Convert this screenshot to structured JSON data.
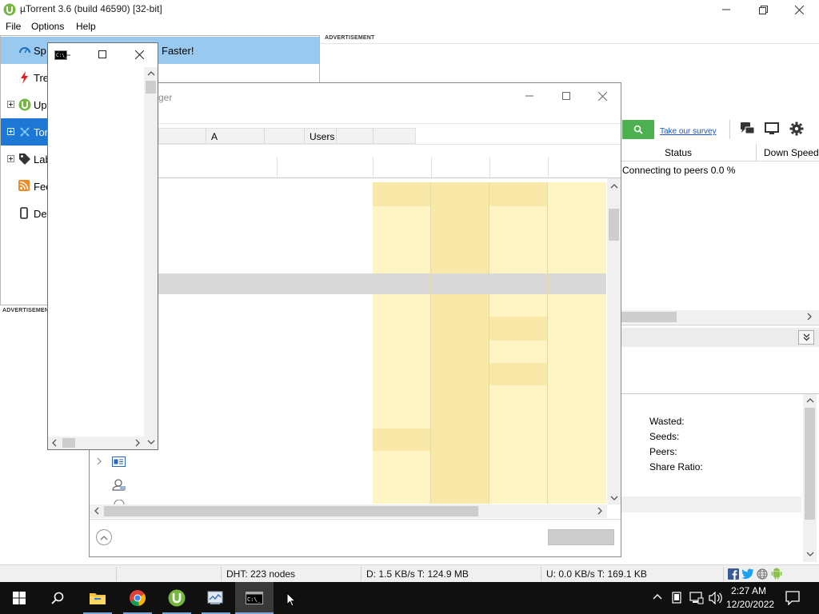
{
  "app": {
    "title": "µTorrent 3.6  (build 46590) [32-bit]",
    "menu": [
      "File",
      "Options",
      "Help"
    ]
  },
  "sidebar": {
    "items": [
      {
        "label": "Sp",
        "icon": "speedometer-icon"
      },
      {
        "label": "Tre",
        "icon": "lightning-icon"
      },
      {
        "label": "Up",
        "icon": "utorrent-icon"
      },
      {
        "label": "Tor",
        "icon": "torrents-icon"
      },
      {
        "label": "Lab",
        "icon": "tag-icon"
      },
      {
        "label": "Fee",
        "icon": "rss-icon"
      },
      {
        "label": "Dev",
        "icon": "device-icon"
      }
    ],
    "promo_text": "Faster!"
  },
  "ads": {
    "top_label": "ADVERTISEMENT",
    "left_label": "ADVERTISEMENT"
  },
  "toolbar": {
    "survey_link": "Take our survey"
  },
  "torrent_list": {
    "columns": [
      "Status",
      "Down Speed"
    ],
    "rows": [
      {
        "status": "Connecting to peers 0.0 %"
      }
    ]
  },
  "info_panel": {
    "fields": [
      "Wasted:",
      "Seeds:",
      "Peers:",
      "Share Ratio:"
    ]
  },
  "statusbar": {
    "dht": "DHT: 223 nodes",
    "download": "D: 1.5 KB/s T: 124.9 MB",
    "upload": "U: 0.0 KB/s T: 169.1 KB"
  },
  "task_manager": {
    "title_fragment": "ger",
    "header_cols": [
      "A",
      "Users"
    ]
  },
  "taskbar": {
    "time": "2:27 AM",
    "date": "12/20/2022"
  },
  "colors": {
    "selected_blue": "#1c78d4",
    "hover_blue": "#99c9ef",
    "heat_yellow": "#fff4c4",
    "taskbar": "#101010",
    "green_search": "#4caf50"
  }
}
